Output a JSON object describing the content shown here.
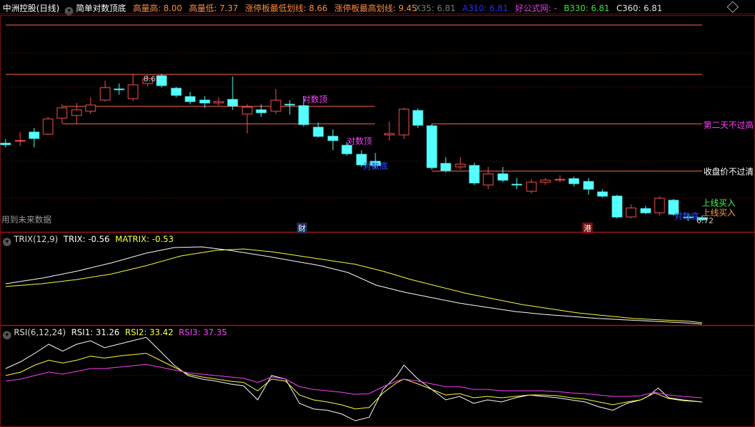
{
  "header": {
    "title": "中洲控股(日线)",
    "indicator": "简单对数顶底",
    "items": [
      {
        "label": "高量高: 8.00",
        "color": "#ff8c40"
      },
      {
        "label": "高量低: 7.37",
        "color": "#ff8c40"
      },
      {
        "label": "涨停板最低划线: 8.66",
        "color": "#ff8c40"
      },
      {
        "label": "涨停板最高划线: 9.45",
        "color": "#ff8c40"
      }
    ],
    "right_items": [
      {
        "label": "X35: 6.81",
        "color": "#7a7a7a"
      },
      {
        "label": "A310: 6.81",
        "color": "#2a2aff"
      },
      {
        "label": "好公式网: -",
        "color": "#e040e0"
      },
      {
        "label": "B330: 6.81",
        "color": "#40e040"
      },
      {
        "label": "C360: 6.81",
        "color": "#e0e0e0"
      }
    ]
  },
  "main_chart": {
    "annotations": {
      "peak_price": "8.61",
      "top1": "对数顶",
      "top2": "对数顶",
      "bottom1": "对数底",
      "bottom2": "对数底",
      "right_second_day": "第二天不过高",
      "right_close": "收盘价不过清",
      "right_buy1": "上线买入",
      "right_buy2": "上线买入",
      "last_price": "6.72",
      "future_data": "用到未来数据",
      "badge_cai": "财",
      "badge_gang": "港"
    },
    "colors": {
      "up": "#ff5050",
      "down": "#54ffff",
      "hline": "#ff6a50"
    }
  },
  "trix_pane": {
    "title": "TRIX(12,9)",
    "trix": "TRIX: -0.56",
    "matrix": "MATRIX: -0.53",
    "colors": {
      "trix": "#ffffff",
      "matrix": "#ffff40"
    }
  },
  "rsi_pane": {
    "title": "RSI(6,12,24)",
    "rsi1": "RSI1: 31.26",
    "rsi2": "RSI2: 33.42",
    "rsi3": "RSI3: 37.35",
    "colors": {
      "rsi1": "#ffffff",
      "rsi2": "#ffff40",
      "rsi3": "#ff40ff"
    }
  }
}
